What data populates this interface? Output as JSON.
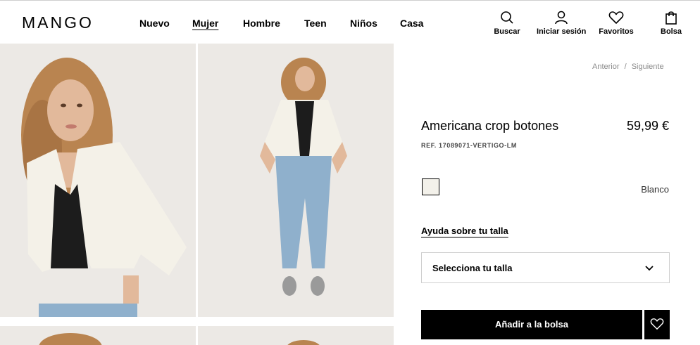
{
  "brand": {
    "logo_text": "MANGO"
  },
  "nav": {
    "items": [
      {
        "label": "Nuevo",
        "active": false
      },
      {
        "label": "Mujer",
        "active": true
      },
      {
        "label": "Hombre",
        "active": false
      },
      {
        "label": "Teen",
        "active": false
      },
      {
        "label": "Niños",
        "active": false
      },
      {
        "label": "Casa",
        "active": false
      }
    ]
  },
  "utility": {
    "search": {
      "label": "Buscar",
      "icon": "search-icon"
    },
    "login": {
      "label": "Iniciar sesión",
      "icon": "user-icon"
    },
    "favorites": {
      "label": "Favoritos",
      "icon": "heart-icon"
    },
    "bag": {
      "label": "Bolsa",
      "icon": "bag-icon"
    }
  },
  "pager": {
    "previous": "Anterior",
    "separator": "/",
    "next": "Siguiente"
  },
  "product": {
    "name": "Americana crop botones",
    "price": "59,99 €",
    "reference": "REF. 17089071-VERTIGO-LM",
    "color": {
      "name": "Blanco",
      "swatch": "#f3f1ea"
    },
    "size_help": "Ayuda sobre tu talla",
    "size_select": {
      "placeholder": "Selecciona tu talla"
    },
    "add_to_bag": "Añadir a la bolsa"
  },
  "colors": {
    "accent": "#000000",
    "photo_bg": "#ece9e5",
    "jacket": "#f4f1e8",
    "jeans": "#8fb0cc",
    "hair": "#b98450",
    "skin": "#e2b99b"
  }
}
